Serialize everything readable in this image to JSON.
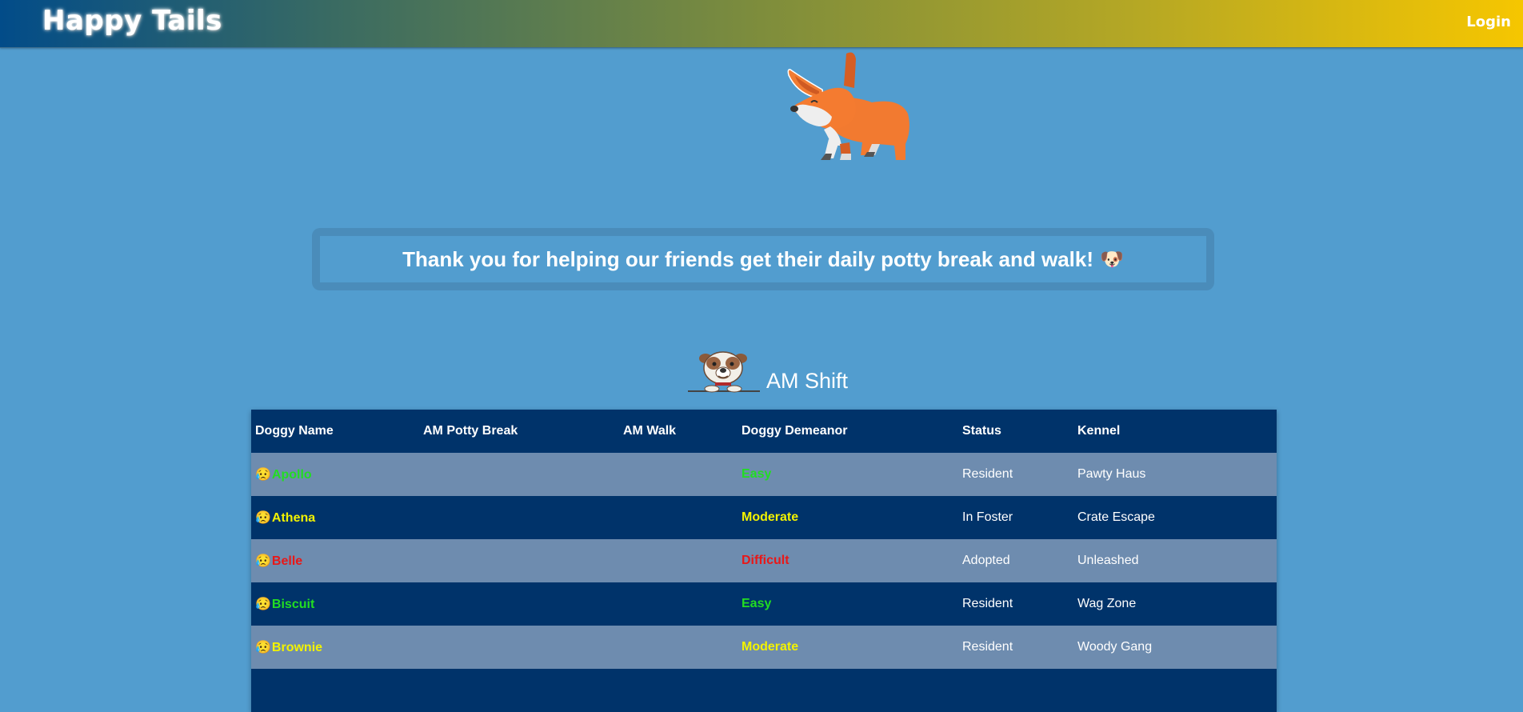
{
  "header": {
    "brand": "Happy Tails",
    "login_label": "Login"
  },
  "banner": {
    "message": "Thank you for helping our friends get their daily potty break and walk!",
    "emoji": "🐶"
  },
  "shift": {
    "title": "AM Shift"
  },
  "table": {
    "columns": [
      "Doggy Name",
      "AM Potty Break",
      "AM Walk",
      "Doggy Demeanor",
      "Status",
      "Kennel"
    ],
    "rows": [
      {
        "face": "😥",
        "name": "Apollo",
        "potty": "",
        "walk": "",
        "demeanor": "Easy",
        "status": "Resident",
        "kennel": "Pawty Haus"
      },
      {
        "face": "😥",
        "name": "Athena",
        "potty": "",
        "walk": "",
        "demeanor": "Moderate",
        "status": "In Foster",
        "kennel": "Crate Escape"
      },
      {
        "face": "😥",
        "name": "Belle",
        "potty": "",
        "walk": "",
        "demeanor": "Difficult",
        "status": "Adopted",
        "kennel": "Unleashed"
      },
      {
        "face": "😥",
        "name": "Biscuit",
        "potty": "",
        "walk": "",
        "demeanor": "Easy",
        "status": "Resident",
        "kennel": "Wag Zone"
      },
      {
        "face": "😥",
        "name": "Brownie",
        "potty": "",
        "walk": "",
        "demeanor": "Moderate",
        "status": "Resident",
        "kennel": "Woody Gang"
      }
    ]
  },
  "colors": {
    "Easy": "#22dd22",
    "Moderate": "#f2f200",
    "Difficult": "#e81818"
  }
}
